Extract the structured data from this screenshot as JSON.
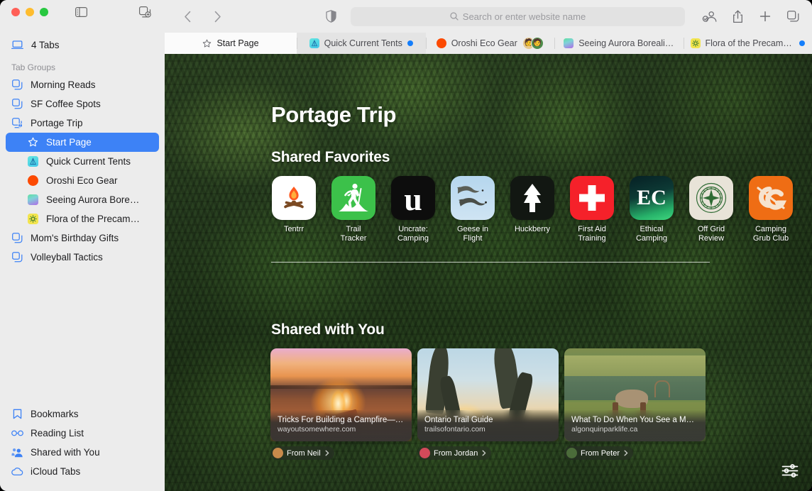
{
  "window": {
    "traffic_lights": [
      "close",
      "minimize",
      "zoom"
    ]
  },
  "sidebar": {
    "tabs_count_label": "4 Tabs",
    "group_header": "Tab Groups",
    "tab_groups": [
      {
        "label": "Morning Reads",
        "icon": "tab-group-icon"
      },
      {
        "label": "SF Coffee Spots",
        "icon": "tab-group-icon"
      },
      {
        "label": "Portage Trip",
        "icon": "tab-group-shared-icon"
      }
    ],
    "portage_children": [
      {
        "label": "Start Page",
        "icon": "star-icon",
        "selected": true
      },
      {
        "label": "Quick Current Tents",
        "icon": "site-favicon-tents",
        "selected": false
      },
      {
        "label": "Oroshi Eco Gear",
        "icon": "site-favicon-oroshi",
        "selected": false
      },
      {
        "label": "Seeing Aurora Bore…",
        "icon": "site-favicon-aurora",
        "selected": false
      },
      {
        "label": "Flora of the Precam…",
        "icon": "site-favicon-flora",
        "selected": false
      }
    ],
    "tab_groups_after": [
      {
        "label": "Mom's Birthday Gifts",
        "icon": "tab-group-icon"
      },
      {
        "label": "Volleyball Tactics",
        "icon": "tab-group-icon"
      }
    ],
    "bottom_items": [
      {
        "label": "Bookmarks",
        "icon": "bookmark-icon"
      },
      {
        "label": "Reading List",
        "icon": "glasses-icon"
      },
      {
        "label": "Shared with You",
        "icon": "people-icon"
      },
      {
        "label": "iCloud Tabs",
        "icon": "cloud-icon"
      }
    ]
  },
  "toolbar": {
    "back_label": "Back",
    "forward_label": "Forward",
    "shield_label": "Privacy Report",
    "address_placeholder": "Search or enter website name",
    "address_value": "",
    "search_icon": "search-icon",
    "buttons": [
      {
        "name": "share-participants-button",
        "icon": "person-badge-icon"
      },
      {
        "name": "share-button",
        "icon": "share-icon"
      },
      {
        "name": "new-tab-button",
        "icon": "plus-icon"
      },
      {
        "name": "tab-overview-button",
        "icon": "tab-overview-icon"
      }
    ]
  },
  "tabbar": {
    "tabs": [
      {
        "label": "Start Page",
        "icon": "star-icon",
        "active": true,
        "badge": ""
      },
      {
        "label": "Quick Current Tents",
        "icon": "site-favicon-tents",
        "active": false,
        "badge": "blue-dot"
      },
      {
        "label": "Oroshi Eco Gear",
        "icon": "site-favicon-oroshi",
        "active": false,
        "badge": "avatars"
      },
      {
        "label": "Seeing Aurora Boreali…",
        "icon": "site-favicon-aurora",
        "active": false,
        "badge": ""
      },
      {
        "label": "Flora of the Precambi…",
        "icon": "site-favicon-flora",
        "active": false,
        "badge": "blue-dot"
      }
    ]
  },
  "start_page": {
    "title": "Portage Trip",
    "favorites_heading": "Shared Favorites",
    "shared_heading": "Shared with You",
    "favorites": [
      {
        "name": "Tentrr",
        "icon": "campfire-icon",
        "bg": "#ffffff"
      },
      {
        "name": "Trail\nTracker",
        "icon": "hiker-icon",
        "bg": "#3cc14a"
      },
      {
        "name": "Uncrate:\nCamping",
        "icon": "letter-u-icon",
        "bg": "#0d0d0d"
      },
      {
        "name": "Geese in\nFlight",
        "icon": "geese-icon",
        "bg": "#b9d8ef"
      },
      {
        "name": "Huckberry",
        "icon": "pine-tree-icon",
        "bg": "#111611"
      },
      {
        "name": "First Aid\nTraining",
        "icon": "red-cross-icon",
        "bg": "#f5212a"
      },
      {
        "name": "Ethical\nCamping",
        "icon": "letters-ec-icon",
        "bg": "#0b2c2e"
      },
      {
        "name": "Off Grid\nReview",
        "icon": "compass-icon",
        "bg": "#e8e3d8"
      },
      {
        "name": "Camping\nGrub Club",
        "icon": "letters-cg-icon",
        "bg": "#ef6d14"
      }
    ],
    "shared_with_you": [
      {
        "title": "Tricks For Building a Campfire—F…",
        "domain": "wayoutsomewhere.com",
        "from": "From Neil",
        "image": "campfire-at-sunset-photo",
        "avatar_color": "#c98a4b"
      },
      {
        "title": "Ontario Trail Guide",
        "domain": "trailsofontario.com",
        "from": "From Jordan",
        "image": "hikers-silhouette-sunset-photo",
        "avatar_color": "#d24a5a"
      },
      {
        "title": "What To Do When You See a Moo…",
        "domain": "algonquinparklife.ca",
        "from": "From Peter",
        "image": "elk-grazing-by-pond-photo",
        "avatar_color": "#4b6b3a"
      }
    ],
    "settings_button": "page-settings-button"
  },
  "colors": {
    "accent": "#3d82f6",
    "sidebar_bg": "#ececec",
    "active_tab_bg": "#fbfbfb",
    "blue_dot": "#147efb"
  }
}
